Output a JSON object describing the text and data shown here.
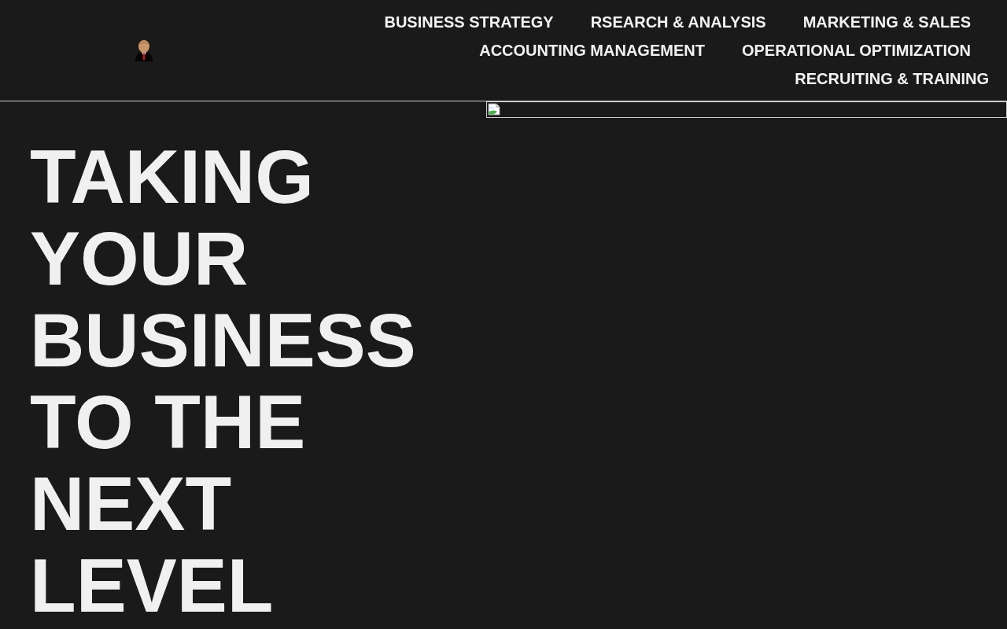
{
  "header": {
    "nav": [
      {
        "label": "BUSINESS STRATEGY"
      },
      {
        "label": "RSEARCH & ANALYSIS"
      },
      {
        "label": "MARKETING & SALES"
      },
      {
        "label": "ACCOUNTING MANAGEMENT"
      },
      {
        "label": "OPERATIONAL OPTIMIZATION"
      },
      {
        "label": "RECRUITING & TRAINING"
      }
    ]
  },
  "hero": {
    "heading": "TAKING YOUR BUSINESS TO THE NEXT LEVEL"
  }
}
